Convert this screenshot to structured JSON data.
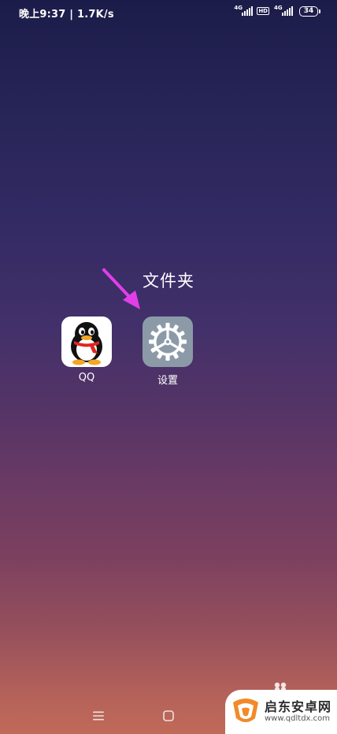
{
  "status_bar": {
    "time": "晚上9:37",
    "separator": "|",
    "net_speed": "1.7K/s",
    "sim1_network": "4G",
    "hd_label": "HD",
    "sim2_network": "4G",
    "battery_level": "34"
  },
  "folder": {
    "title": "文件夹",
    "apps": [
      {
        "label": "QQ",
        "icon": "qq-penguin-icon"
      },
      {
        "label": "设置",
        "icon": "gear-icon"
      }
    ]
  },
  "annotation": {
    "arrow_color": "#e23ee8"
  },
  "nav_bar": {
    "buttons": [
      "menu-icon",
      "home-icon"
    ]
  },
  "watermark": {
    "name": "启东安卓网",
    "url": "www.qdltdx.com",
    "accent": "#f08a2a"
  },
  "colors": {
    "settings_icon_bg": "#8c9aa8",
    "qq_scarf": "#e0251f",
    "qq_feet": "#f5a623"
  }
}
